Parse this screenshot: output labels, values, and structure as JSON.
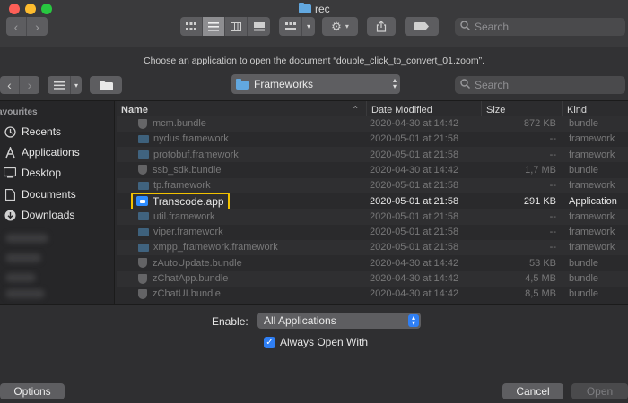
{
  "window": {
    "title": "rec"
  },
  "toolbar": {
    "back_icon": "chevron-left-icon",
    "forward_icon": "chevron-right-icon",
    "search_placeholder": "Search"
  },
  "prompt": {
    "text": "Choose an application to open the document “double_click_to_convert_01.zoom”."
  },
  "nav": {
    "location": "Frameworks",
    "search_placeholder": "Search"
  },
  "sidebar": {
    "header": "Favourites",
    "items": [
      {
        "label": "Recents",
        "icon": "clock-icon"
      },
      {
        "label": "Applications",
        "icon": "applications-icon"
      },
      {
        "label": "Desktop",
        "icon": "desktop-icon"
      },
      {
        "label": "Documents",
        "icon": "document-icon"
      },
      {
        "label": "Downloads",
        "icon": "download-icon"
      }
    ]
  },
  "table": {
    "columns": [
      "Name",
      "Date Modified",
      "Size",
      "Kind"
    ],
    "rows": [
      {
        "name": "mcm.bundle",
        "date": "2020-04-30 at 14:42",
        "size": "872 KB",
        "kind": "bundle",
        "icon": "shield"
      },
      {
        "name": "nydus.framework",
        "date": "2020-05-01 at 21:58",
        "size": "--",
        "kind": "framework",
        "icon": "folder"
      },
      {
        "name": "protobuf.framework",
        "date": "2020-05-01 at 21:58",
        "size": "--",
        "kind": "framework",
        "icon": "folder"
      },
      {
        "name": "ssb_sdk.bundle",
        "date": "2020-04-30 at 14:42",
        "size": "1,7 MB",
        "kind": "bundle",
        "icon": "shield"
      },
      {
        "name": "tp.framework",
        "date": "2020-05-01 at 21:58",
        "size": "--",
        "kind": "framework",
        "icon": "folder"
      },
      {
        "name": "Transcode.app",
        "date": "2020-05-01 at 21:58",
        "size": "291 KB",
        "kind": "Application",
        "icon": "app"
      },
      {
        "name": "util.framework",
        "date": "2020-05-01 at 21:58",
        "size": "--",
        "kind": "framework",
        "icon": "folder"
      },
      {
        "name": "viper.framework",
        "date": "2020-05-01 at 21:58",
        "size": "--",
        "kind": "framework",
        "icon": "folder"
      },
      {
        "name": "xmpp_framework.framework",
        "date": "2020-05-01 at 21:58",
        "size": "--",
        "kind": "framework",
        "icon": "folder"
      },
      {
        "name": "zAutoUpdate.bundle",
        "date": "2020-04-30 at 14:42",
        "size": "53 KB",
        "kind": "bundle",
        "icon": "shield"
      },
      {
        "name": "zChatApp.bundle",
        "date": "2020-04-30 at 14:42",
        "size": "4,5 MB",
        "kind": "bundle",
        "icon": "shield"
      },
      {
        "name": "zChatUI.bundle",
        "date": "2020-04-30 at 14:42",
        "size": "8,5 MB",
        "kind": "bundle",
        "icon": "shield"
      }
    ]
  },
  "bottom": {
    "enable_label": "Enable:",
    "enable_value": "All Applications",
    "always_open_label": "Always Open With",
    "options_label": "Options",
    "cancel_label": "Cancel",
    "open_label": "Open"
  },
  "colors": {
    "accent": "#2f7ff4",
    "highlight": "#f2c200",
    "background": "#2a2a2c"
  }
}
